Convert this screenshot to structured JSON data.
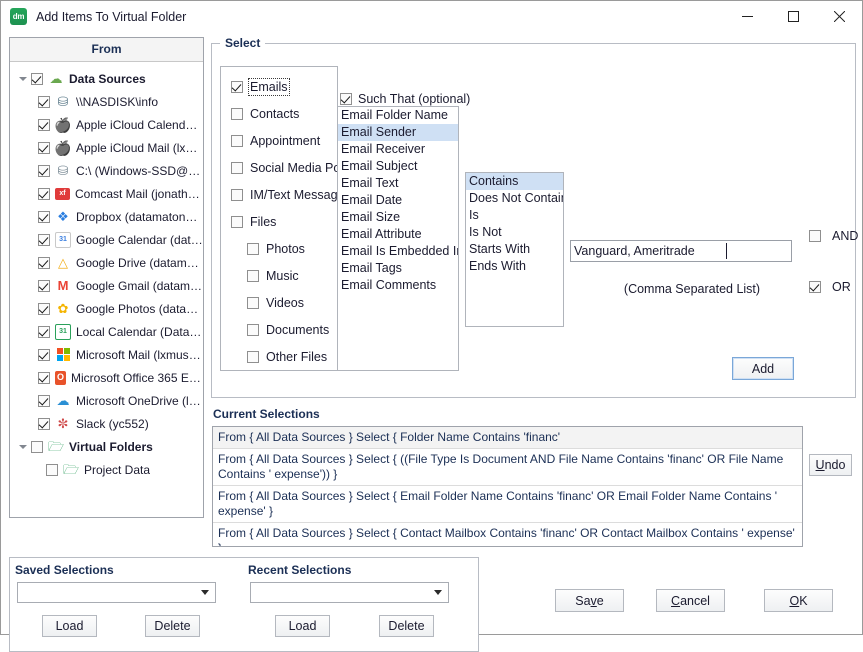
{
  "window": {
    "title": "Add Items To Virtual Folder",
    "app_icon": "dm",
    "minimize_icon": "minimize-icon",
    "maximize_icon": "maximize-icon",
    "close_icon": "close-icon"
  },
  "from_panel": {
    "header": "From",
    "tree": [
      {
        "label": "Data Sources",
        "level": 0,
        "checked": true,
        "bold": true,
        "expanded": true,
        "icon": "cloud-icon"
      },
      {
        "label": "\\\\NASDISK\\info",
        "level": 1,
        "checked": true,
        "icon": "network-drive-icon"
      },
      {
        "label": "Apple iCloud Calendar…",
        "level": 1,
        "checked": true,
        "icon": "apple-icon"
      },
      {
        "label": "Apple iCloud Mail (lxm…",
        "level": 1,
        "checked": true,
        "icon": "apple-icon"
      },
      {
        "label": "C:\\ (Windows-SSD@R…",
        "level": 1,
        "checked": true,
        "icon": "hard-drive-icon"
      },
      {
        "label": "Comcast Mail (jonatha…",
        "level": 1,
        "checked": true,
        "icon": "xfinity-icon"
      },
      {
        "label": "Dropbox (datamaton…",
        "level": 1,
        "checked": true,
        "icon": "dropbox-icon"
      },
      {
        "label": "Google Calendar (dat…",
        "level": 1,
        "checked": true,
        "icon": "google-calendar-icon"
      },
      {
        "label": "Google Drive (datama…",
        "level": 1,
        "checked": true,
        "icon": "google-drive-icon"
      },
      {
        "label": "Google Gmail (datama…",
        "level": 1,
        "checked": true,
        "icon": "gmail-icon"
      },
      {
        "label": "Google Photos (datam…",
        "level": 1,
        "checked": true,
        "icon": "google-photos-icon"
      },
      {
        "label": "Local Calendar (Data…",
        "level": 1,
        "checked": true,
        "icon": "local-calendar-icon"
      },
      {
        "label": "Microsoft Mail (lxmuser)",
        "level": 1,
        "checked": true,
        "icon": "microsoft-icon"
      },
      {
        "label": "Microsoft Office 365 E…",
        "level": 1,
        "checked": true,
        "icon": "office365-icon"
      },
      {
        "label": "Microsoft OneDrive (l…",
        "level": 1,
        "checked": true,
        "icon": "onedrive-icon"
      },
      {
        "label": "Slack (yc552)",
        "level": 1,
        "checked": true,
        "icon": "slack-icon"
      },
      {
        "label": "Virtual Folders",
        "level": 0,
        "checked": false,
        "bold": true,
        "expanded": true,
        "icon": "virtual-folder-icon"
      },
      {
        "label": "Project Data",
        "level": 2,
        "checked": false,
        "icon": "virtual-folder-icon"
      }
    ]
  },
  "select_group": {
    "title": "Select",
    "item_types": [
      {
        "label": "Emails",
        "checked": true,
        "sub": false,
        "focused": true
      },
      {
        "label": "Contacts",
        "checked": false,
        "sub": false
      },
      {
        "label": "Appointment",
        "checked": false,
        "sub": false
      },
      {
        "label": "Social Media Post",
        "checked": false,
        "sub": false
      },
      {
        "label": "IM/Text Messages",
        "checked": false,
        "sub": false
      },
      {
        "label": "Files",
        "checked": false,
        "sub": false
      },
      {
        "label": "Photos",
        "checked": false,
        "sub": true
      },
      {
        "label": "Music",
        "checked": false,
        "sub": true
      },
      {
        "label": "Videos",
        "checked": false,
        "sub": true
      },
      {
        "label": "Documents",
        "checked": false,
        "sub": true
      },
      {
        "label": "Other Files",
        "checked": false,
        "sub": true
      }
    ],
    "such_that": {
      "label": "Such That  (optional)",
      "checked": true
    },
    "attributes": [
      "Email Folder Name",
      "Email Sender",
      "Email Receiver",
      "Email Subject",
      "Email Text",
      "Email Date",
      "Email Size",
      "Email Attribute",
      "Email Is Embedded In",
      "Email Tags",
      "Email Comments"
    ],
    "attribute_selected": "Email Sender",
    "operators": [
      "Contains",
      "Does Not Contain",
      "Is",
      "Is Not",
      "Starts With",
      "Ends With"
    ],
    "operator_selected": "Contains",
    "value_input": {
      "value": "Vanguard, Ameritrade",
      "placeholder": "",
      "hint": "(Comma Separated List)"
    },
    "and_checkbox": {
      "label": "AND",
      "checked": false
    },
    "or_checkbox": {
      "label": "OR",
      "checked": true
    },
    "add_button": "Add"
  },
  "current_selections": {
    "title": "Current Selections",
    "undo_button": {
      "text": "Undo",
      "mnemonic": "U"
    },
    "rows": [
      "From { All Data Sources } Select { Folder Name Contains 'financ'",
      "From { All Data Sources } Select { ((File Type Is Document AND File Name Contains 'financ' OR File Name Contains ' expense')) }",
      "From { All Data Sources } Select { Email Folder Name Contains 'financ' OR Email Folder Name Contains ' expense' }",
      "From { All Data Sources } Select { Contact Mailbox Contains 'financ' OR Contact Mailbox Contains ' expense' }"
    ]
  },
  "saved_selections": {
    "title": "Saved Selections",
    "combo_value": "",
    "load_button": "Load",
    "delete_button": "Delete"
  },
  "recent_selections": {
    "title": "Recent Selections",
    "combo_value": "",
    "load_button": "Load",
    "delete_button": "Delete"
  },
  "dialog_buttons": {
    "save": {
      "pre": "Sa",
      "mnemonic": "v",
      "post": "e"
    },
    "cancel": {
      "pre": "",
      "mnemonic": "C",
      "post": "ancel"
    },
    "ok": {
      "pre": "",
      "mnemonic": "O",
      "post": "K"
    }
  },
  "colors": {
    "accent_blue": "#cfe0f4",
    "title_navy": "#1b2f55",
    "panel_border": "#9fa3ab",
    "app_green": "#1d9150"
  }
}
